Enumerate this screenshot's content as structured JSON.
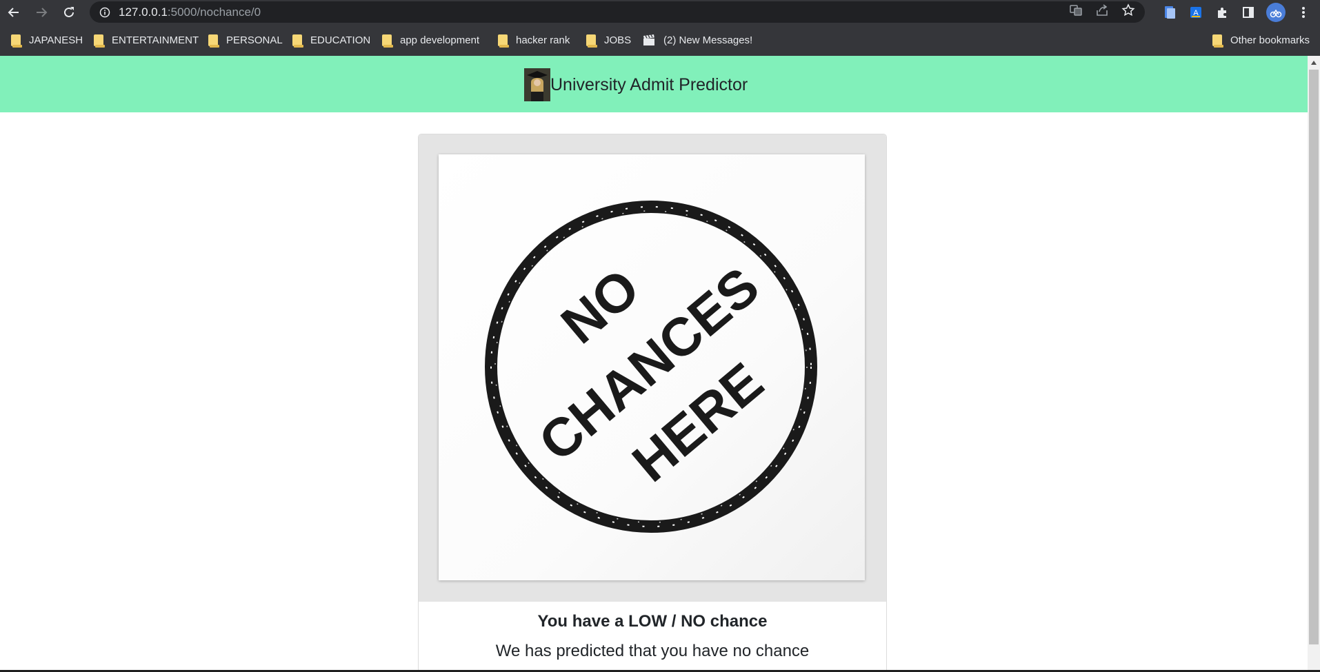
{
  "browser": {
    "url_host": "127.0.0.1",
    "url_path": ":5000/nochance/0",
    "bookmarks": [
      {
        "label": "JAPANESH",
        "icon": "folder-icon"
      },
      {
        "label": "ENTERTAINMENT",
        "icon": "folder-icon"
      },
      {
        "label": "PERSONAL",
        "icon": "folder-icon"
      },
      {
        "label": "EDUCATION",
        "icon": "folder-icon"
      },
      {
        "label": "app development",
        "icon": "folder-icon"
      },
      {
        "label": "hacker rank",
        "icon": "folder-icon"
      },
      {
        "label": "JOBS",
        "icon": "folder-icon"
      },
      {
        "label": "(2) New Messages!",
        "icon": "clapperboard-icon"
      }
    ],
    "other_bookmarks": "Other bookmarks"
  },
  "header": {
    "title": "University Admit Predictor",
    "background": "#81f0ba"
  },
  "card": {
    "stamp": {
      "line1": "NO",
      "line2": "CHANCES",
      "line3": "HERE"
    },
    "title": "You have a LOW / NO chance",
    "text": "We has predicted that you have no chance"
  }
}
